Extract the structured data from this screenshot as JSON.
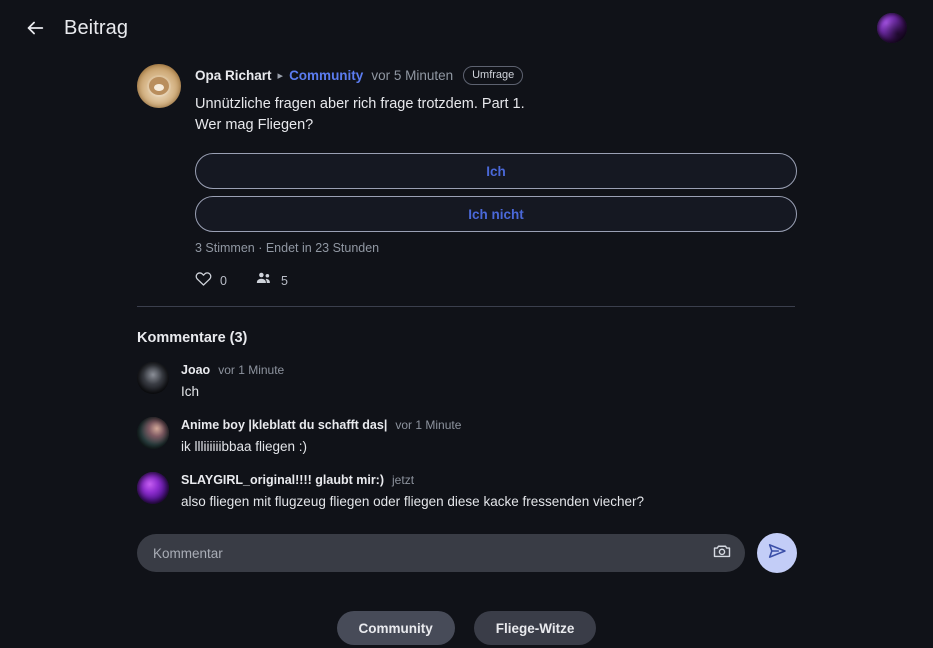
{
  "header": {
    "back_icon": "arrow-left-icon",
    "title": "Beitrag",
    "avatar_icon": "user-avatar"
  },
  "post": {
    "author": "Opa Richart",
    "separator": "▸",
    "community": "Community",
    "timestamp": "vor 5 Minuten",
    "badge": "Umfrage",
    "text_line1": "Unnützliche fragen aber rich frage trotzdem. Part 1.",
    "text_line2": "Wer mag Fliegen?",
    "poll": {
      "options": [
        {
          "label": "Ich"
        },
        {
          "label": "Ich nicht"
        }
      ],
      "info": "3 Stimmen · Endet in 23 Stunden"
    },
    "reactions": [
      {
        "icon": "heart-icon",
        "count": "0"
      },
      {
        "icon": "people-icon",
        "count": "5"
      }
    ]
  },
  "comments_section": {
    "title": "Kommentare (3)",
    "items": [
      {
        "name": "Joao",
        "time": "vor 1 Minute",
        "text": "Ich"
      },
      {
        "name": "Anime boy |kleblatt du schafft das|",
        "time": "vor 1 Minute",
        "text": "ik llliiiiiibbaa fliegen :)"
      },
      {
        "name": "SLAYGIRL_original!!!! glaubt mir:)",
        "time": "jetzt",
        "text": "also fliegen mit flugzeug fliegen oder fliegen diese kacke fressenden viecher?"
      }
    ]
  },
  "composer": {
    "placeholder": "Kommentar",
    "value": "",
    "camera_icon": "camera-icon",
    "send_icon": "send-icon"
  },
  "tags": [
    {
      "label": "Community"
    },
    {
      "label": "Fliege-Witze"
    }
  ],
  "colors": {
    "background": "#101218",
    "accent_blue": "#4a68d8",
    "link_blue": "#5b7cf0",
    "send_button": "#c3cdf7",
    "divider": "#3b3f4d"
  }
}
